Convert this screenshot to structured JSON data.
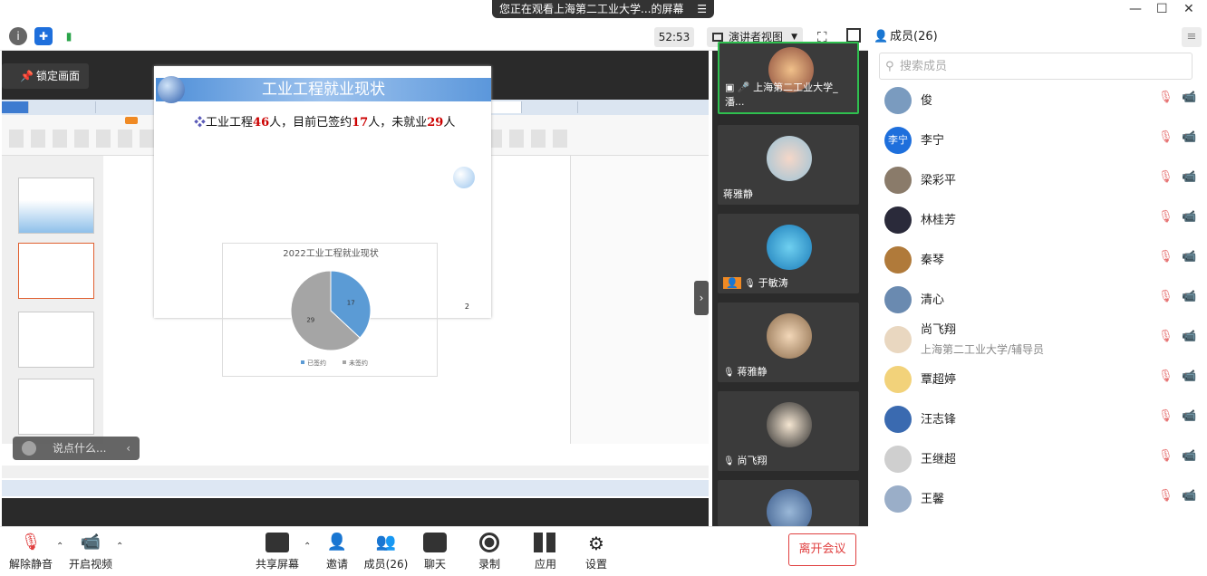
{
  "banner": {
    "text": "您正在观看上海第二工业大学...的屏幕",
    "menu_icon": "menu-icon"
  },
  "toolbar": {
    "timer": "52:53",
    "view_mode": "演讲者视图"
  },
  "window_controls": {
    "minimize": "—",
    "maximize": "☐",
    "close": "✕"
  },
  "stage": {
    "lock_label": "锁定画面",
    "chat_placeholder": "说点什么...",
    "slide": {
      "title": "工业工程就业现状",
      "line_prefix": "工业工程",
      "total": "46",
      "mid1": "人，目前已签约",
      "signed": "17",
      "mid2": "人，未就业",
      "unemployed": "29",
      "suffix": "人",
      "page": "2"
    }
  },
  "chart_data": {
    "type": "pie",
    "title": "2022工业工程就业现状",
    "categories": [
      "已签约",
      "未签约"
    ],
    "values": [
      17,
      29
    ],
    "colors": [
      "#5b9bd5",
      "#a5a5a5"
    ],
    "legend": "bottom"
  },
  "videos": [
    {
      "name": "上海第二工业大学_潘...",
      "mic": "on"
    },
    {
      "name": "蒋雅静",
      "mic": "none"
    },
    {
      "name": "于敏涛",
      "mic": "off"
    },
    {
      "name": "蒋雅静",
      "mic": "off"
    },
    {
      "name": "尚飞翔",
      "mic": "off"
    }
  ],
  "members": {
    "header": "成员(26)",
    "search_placeholder": "搜索成员",
    "list": [
      {
        "name": "俊",
        "sub": "",
        "avatar_color": "#7a9bbf"
      },
      {
        "name": "李宁",
        "sub": "",
        "avatar_text": "李宁",
        "avatar_color": "#1e6fdc"
      },
      {
        "name": "梁彩平",
        "sub": "",
        "avatar_color": "#8a7b6a"
      },
      {
        "name": "林桂芳",
        "sub": "",
        "avatar_color": "#2a2a3a"
      },
      {
        "name": "秦琴",
        "sub": "",
        "avatar_color": "#b07a3a"
      },
      {
        "name": "清心",
        "sub": "",
        "avatar_color": "#6a8ab0"
      },
      {
        "name": "尚飞翔",
        "sub": "上海第二工业大学/辅导员",
        "avatar_color": "#e9d7c0"
      },
      {
        "name": "覃超婷",
        "sub": "",
        "avatar_color": "#f2d27a"
      },
      {
        "name": "汪志锋",
        "sub": "",
        "avatar_color": "#3a6ab0"
      },
      {
        "name": "王继超",
        "sub": "",
        "avatar_color": "#cfcfcf"
      },
      {
        "name": "王馨",
        "sub": "",
        "avatar_color": "#9aaec8"
      }
    ]
  },
  "bottom": {
    "unmute": "解除静音",
    "video": "开启视频",
    "share": "共享屏幕",
    "invite": "邀请",
    "members": "成员(26)",
    "chat": "聊天",
    "record": "录制",
    "apps": "应用",
    "settings": "设置",
    "leave": "离开会议"
  }
}
